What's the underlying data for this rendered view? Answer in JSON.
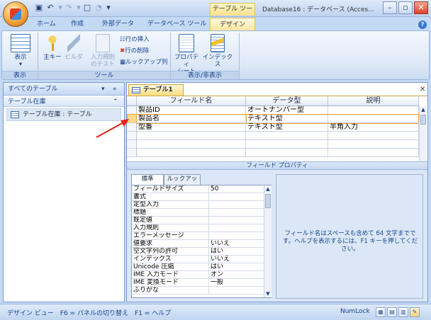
{
  "window": {
    "context_tab": "テーブル ツール",
    "title": "Database16 : データベース (Acces..."
  },
  "ribbon_tabs": [
    "ホーム",
    "作成",
    "外部データ",
    "データベース ツール",
    "デザイン"
  ],
  "ribbon": {
    "views": {
      "label": "表示",
      "group": "表示"
    },
    "tools": {
      "primary_key": "主キー",
      "builder": "ビルダ",
      "test_validation": [
        "入力規則",
        "のテスト"
      ],
      "insert_rows": "行の挿入",
      "delete_rows": "行の削除",
      "lookup_column": "ルックアップ列",
      "group": "ツール"
    },
    "show_hide": {
      "property_sheet": [
        "プロパティ",
        "シート"
      ],
      "indexes": "インデックス",
      "group": "表示/非表示"
    }
  },
  "nav": {
    "header": "すべてのテーブル",
    "group": "テーブル在庫",
    "item": "テーブル在庫 : テーブル"
  },
  "document": {
    "tab": "テーブル1",
    "columns": [
      "フィールド名",
      "データ型",
      "説明"
    ],
    "rows": [
      {
        "field": "製品ID",
        "type": "オートナンバー型",
        "desc": ""
      },
      {
        "field": "製品名",
        "type": "テキスト型",
        "desc": ""
      },
      {
        "field": "型番",
        "type": "テキスト型",
        "desc": "半角入力"
      }
    ],
    "field_properties": "フィールド プロパティ",
    "prop_tabs": [
      "標準",
      "ルックアップ"
    ],
    "properties": [
      {
        "name": "フィールドサイズ",
        "value": "50"
      },
      {
        "name": "書式",
        "value": ""
      },
      {
        "name": "定型入力",
        "value": ""
      },
      {
        "name": "標題",
        "value": ""
      },
      {
        "name": "既定値",
        "value": ""
      },
      {
        "name": "入力規則",
        "value": ""
      },
      {
        "name": "エラーメッセージ",
        "value": ""
      },
      {
        "name": "値要求",
        "value": "いいえ"
      },
      {
        "name": "空文字列の許可",
        "value": "はい"
      },
      {
        "name": "インデックス",
        "value": "いいえ"
      },
      {
        "name": "Unicode 圧縮",
        "value": "はい"
      },
      {
        "name": "IME 入力モード",
        "value": "オン"
      },
      {
        "name": "IME 変換モード",
        "value": "一般"
      },
      {
        "name": "ふりがな",
        "value": ""
      }
    ],
    "hint": "フィールド名はスペースも含めて 64 文字までです。ヘルプを表示するには、F1 キーを押してください。"
  },
  "status": {
    "text": "デザイン ビュー　F6 = パネルの切り替え　F1 = ヘルプ",
    "numlock": "NumLock"
  },
  "colors": {
    "accent": "#15428b",
    "context_tab": "#fbe08b",
    "annotation_arrow": "#e8201a"
  }
}
